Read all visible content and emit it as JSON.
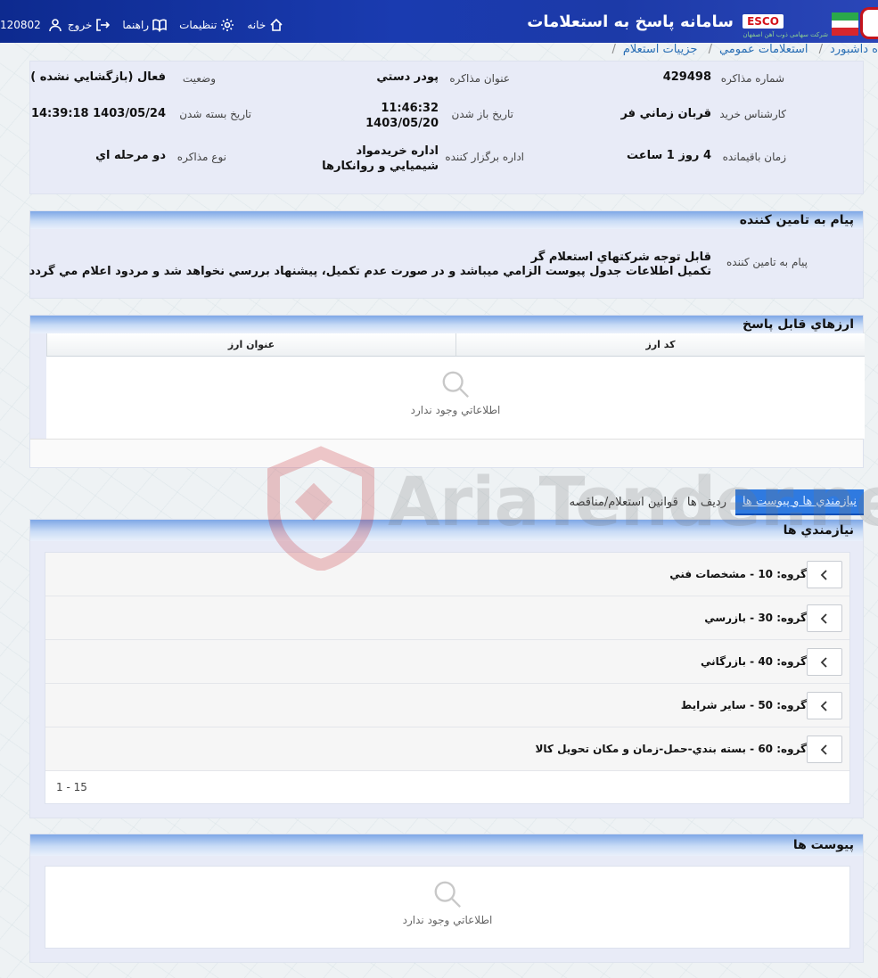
{
  "header": {
    "title": "سامانه پاسخ به استعلامات",
    "brand": "ESCO",
    "brand_sub": "شرکت سهامی ذوب آهن اصفهان",
    "nav": {
      "home": "خانه",
      "settings": "تنظيمات",
      "help": "راهنما",
      "logout": "خروج",
      "user_id": "120802"
    }
  },
  "breadcrumb": [
    "ه داشبورد",
    "استعلامات عمومي",
    "جزييات استعلام"
  ],
  "details": {
    "number_label": "شماره مذاکره",
    "number_value": "429498",
    "title_label": "عنوان مذاکره",
    "title_value": "پودر دستي",
    "status_label": "وضعيت",
    "status_value": "فعال (بازگشايي نشده )",
    "expert_label": "کارشناس خريد",
    "expert_value": "قربان زماني فر",
    "open_label": "تاريخ باز شدن",
    "open_time": "11:46:32",
    "open_date": "1403/05/20",
    "close_label": "تاريخ بسته شدن",
    "close_value": "1403/05/24 14:39:18",
    "remaining_label": "زمان باقيمانده",
    "remaining_value": "4 روز 1 ساعت",
    "organizer_label": "اداره برگزار کننده",
    "organizer_line1": "اداره خريدمواد",
    "organizer_line2": "شيميايي و روانکارها",
    "type_label": "نوع مذاکره",
    "type_value": "دو مرحله اي"
  },
  "supplier_message": {
    "title": "پيام به تامين کننده",
    "label": "پيام به تامين کننده",
    "line1": "قابل توجه شرکتهاي استعلام گر",
    "line2": "تکميل اطلاعات جدول پيوست الزامي ميباشد و در صورت عدم تکميل، پيشنهاد بررسي نخواهد شد و مردود اعلام مي گردد"
  },
  "currencies": {
    "title": "ارزهاي قابل پاسخ",
    "col_code": "کد ارز",
    "col_title": "عنوان ارز",
    "empty": "اطلاعاتي وجود ندارد"
  },
  "tabs": {
    "needs": "نيازمندي ها و پيوست ها",
    "rows": "رديف ها",
    "rules": "قوانين استعلام/مناقصه"
  },
  "needs": {
    "title": "نيازمندي ها",
    "groups": [
      "گروه: 10 - مشخصات فني",
      "گروه: 30 - بازرسي",
      "گروه: 40 - بازرگاني",
      "گروه: 50 - ساير شرايط",
      "گروه: 60 - بسته بندي-حمل-زمان و مکان تحويل کالا"
    ],
    "pager": "1 - 15"
  },
  "attachments": {
    "title": "پيوست ها",
    "empty": "اطلاعاتي وجود ندارد"
  },
  "watermark": "AriaTender.neT"
}
